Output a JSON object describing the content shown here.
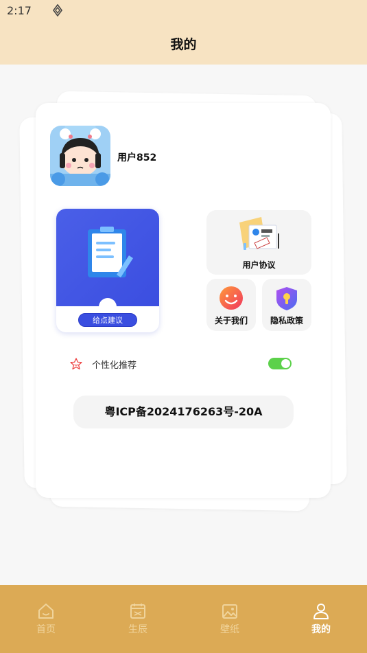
{
  "status_bar": {
    "time": "2:17",
    "icon": "nav-diamond-icon"
  },
  "header": {
    "title": "我的"
  },
  "profile": {
    "username": "用户852",
    "avatar": "cartoon-girl-avatar"
  },
  "tiles": {
    "feedback_label": "给点建议",
    "user_agreement_label": "用户协议",
    "about_label": "关于我们",
    "privacy_label": "隐私政策"
  },
  "settings": {
    "recommend_label": "个性化推荐",
    "recommend_enabled": true
  },
  "icp": {
    "text": "粤ICP备2024176263号-20A"
  },
  "tabbar": {
    "items": [
      {
        "label": "首页",
        "icon": "home-icon",
        "active": false
      },
      {
        "label": "生辰",
        "icon": "calendar-icon",
        "active": false
      },
      {
        "label": "壁纸",
        "icon": "image-icon",
        "active": false
      },
      {
        "label": "我的",
        "icon": "user-icon",
        "active": true
      }
    ]
  },
  "colors": {
    "header_bg": "#f7e3c2",
    "tabbar_bg": "#dcaa55",
    "accent_blue": "#3b4ee0",
    "toggle_on": "#5cd14a"
  }
}
